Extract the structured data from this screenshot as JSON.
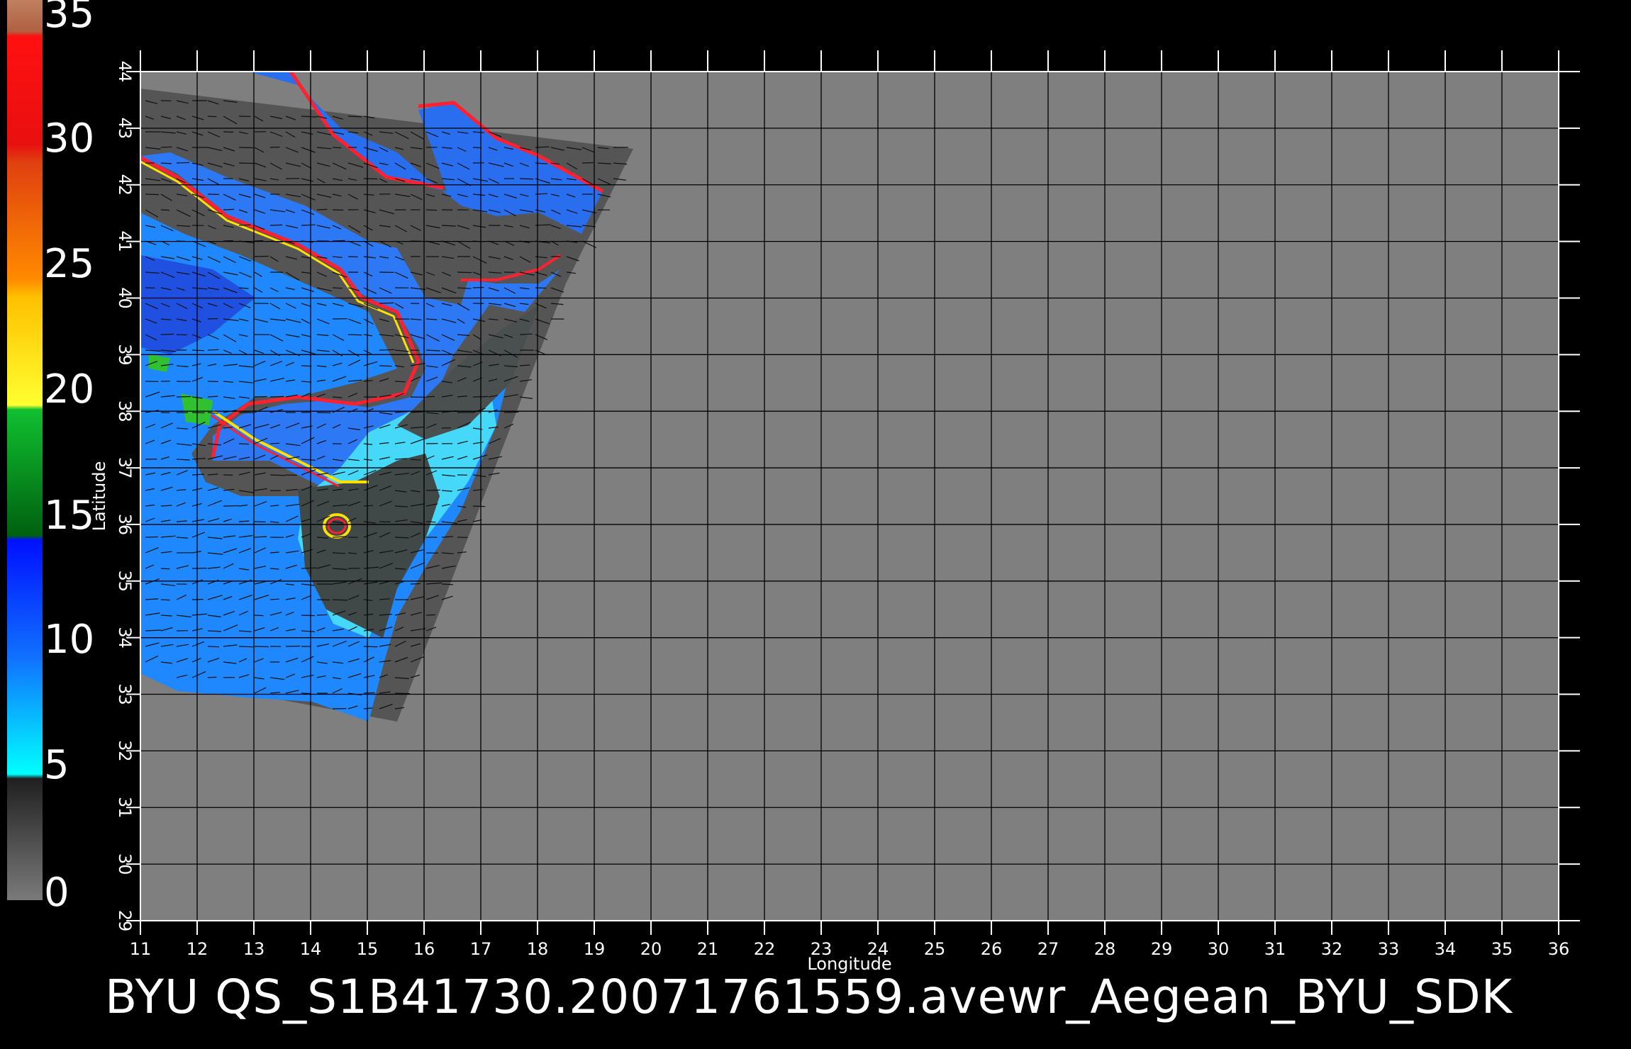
{
  "colorbar": {
    "labels": [
      "35",
      "30",
      "25",
      "20",
      "15",
      "10",
      "5",
      "0"
    ],
    "colors": {
      "top": "#c08060",
      "red": "#ff1010",
      "orange": "#ff6a00",
      "yellow": "#ffd000",
      "green": "#10a020",
      "blue": "#0030ff",
      "cyan": "#00e8ff",
      "gray": "#606060"
    }
  },
  "map": {
    "background_color": "#7f7f7f",
    "grid_color": "#000000",
    "x_axis_label": "Longitude",
    "y_axis_label": "Latitude",
    "x_ticks": [
      "11",
      "12",
      "13",
      "14",
      "15",
      "16",
      "17",
      "18",
      "19",
      "20",
      "21",
      "22",
      "23",
      "24",
      "25",
      "26",
      "27",
      "28",
      "29",
      "30",
      "31",
      "32",
      "33",
      "34",
      "35",
      "36"
    ],
    "y_ticks": [
      "44",
      "43",
      "42",
      "41",
      "40",
      "39",
      "38",
      "37",
      "36",
      "35",
      "34",
      "33",
      "32",
      "31",
      "30",
      "29"
    ],
    "swath_colors": {
      "land": "#555555",
      "ocean_low": "#1e8cff",
      "ocean_mid": "#2060e8",
      "ocean_calm": "#40e0ff",
      "coast_red": "#ff2030",
      "coast_yellow": "#ffe000",
      "coast_green": "#30c030"
    }
  },
  "footer": {
    "title": "BYU  QS_S1B41730.20071761559.avewr_Aegean_BYU_SDK"
  }
}
